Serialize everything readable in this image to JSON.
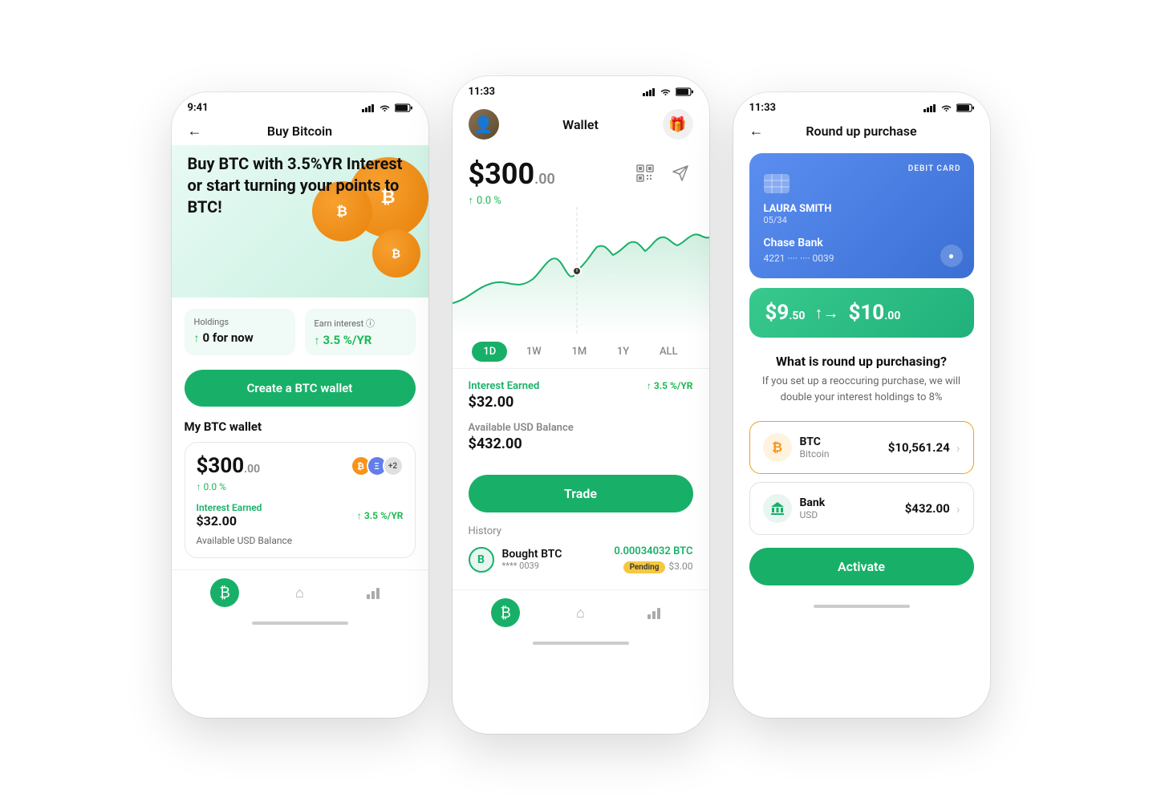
{
  "phone1": {
    "status_time": "9:41",
    "nav_back": "←",
    "nav_title": "Buy Bitcoin",
    "hero_text": "Buy BTC with 3.5%YR Interest or start turning your points to BTC!",
    "holdings_label": "Holdings",
    "holdings_value": "0 for now",
    "earn_label": "Earn interest ⓘ",
    "earn_value": "3.5 %/YR",
    "create_btn": "Create a BTC wallet",
    "my_wallet_label": "My BTC wallet",
    "wallet_amount": "$300",
    "wallet_cents": ".00",
    "wallet_pct": "0.0 %",
    "interest_label": "Interest Earned",
    "interest_value": "$32.00",
    "interest_rate": "3.5 %/YR",
    "avail_label": "Available USD Balance"
  },
  "phone2": {
    "status_time": "11:33",
    "wallet_title": "Wallet",
    "balance": "$300",
    "balance_cents": ".00",
    "balance_pct": "0.0 %",
    "time_options": [
      "1D",
      "1W",
      "1M",
      "1Y",
      "ALL"
    ],
    "active_time": "1D",
    "interest_label": "Interest Earned",
    "interest_value": "$32.00",
    "interest_rate": "3.5 %/YR",
    "avail_label": "Available USD Balance",
    "avail_value": "$432.00",
    "trade_btn": "Trade",
    "history_label": "History",
    "history_action": "Bought BTC",
    "history_card": "**** 0039",
    "history_amount": "0.00034032 BTC",
    "history_status": "Pending",
    "history_usd": "$3.00"
  },
  "phone3": {
    "status_time": "11:33",
    "nav_back": "←",
    "nav_title": "Round up purchase",
    "card_type": "DEBIT CARD",
    "card_holder": "LAURA SMITH",
    "card_exp": "05/34",
    "bank_name": "Chase Bank",
    "card_number": "4221 ···· ···· 0039",
    "amount_before": "$9",
    "amount_before_cents": ".50",
    "amount_after": "$10",
    "amount_after_cents": ".00",
    "question": "What is round up purchasing?",
    "description": "If you set up a reoccuring purchase, we will double your interest holdings to 8%",
    "btc_name": "BTC",
    "btc_full": "Bitcoin",
    "btc_value": "$10,561.24",
    "bank_asset_name": "Bank",
    "bank_asset_sub": "USD",
    "bank_value": "$432.00",
    "activate_btn": "Activate"
  },
  "icons": {
    "btc": "₿",
    "eth": "Ξ",
    "more": "+2",
    "arrow_up": "↑",
    "back": "←",
    "gift": "🎁",
    "bitcoin_nav": "₿",
    "home_nav": "⌂",
    "chart_nav": "▦"
  }
}
